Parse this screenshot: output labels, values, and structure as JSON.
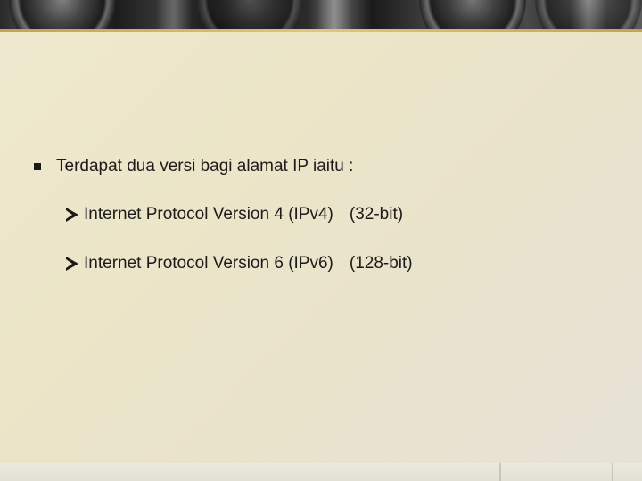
{
  "slide": {
    "main_bullet": "Terdapat dua versi bagi alamat IP iaitu :",
    "sub_items": [
      {
        "label": "Internet Protocol Version 4 (IPv4)",
        "detail": "(32-bit)"
      },
      {
        "label": "Internet Protocol Version 6 (IPv6)",
        "detail": "(128-bit)"
      }
    ]
  },
  "theme": {
    "accent": "#c9a24a",
    "background": "#ece5c8",
    "text": "#1a1a1a"
  },
  "icons": {
    "main_bullet": "square-bullet-icon",
    "sub_bullet": "arrow-bullet-icon"
  }
}
